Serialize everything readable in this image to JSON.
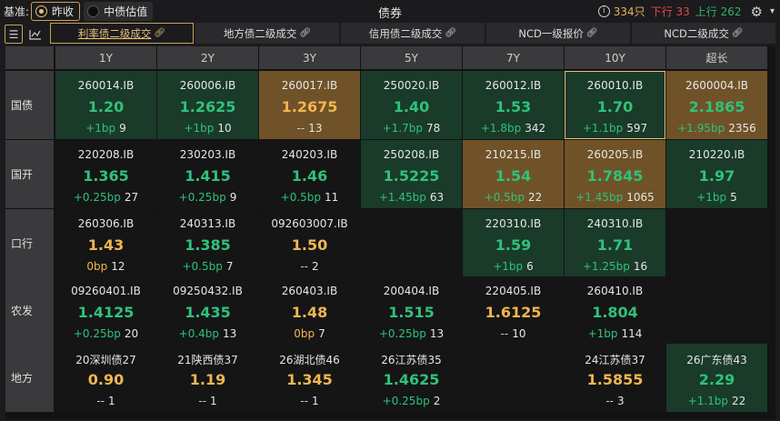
{
  "topbar": {
    "base_label": "基准:",
    "options": [
      {
        "label": "昨收",
        "selected": true
      },
      {
        "label": "中债估值",
        "selected": false
      }
    ],
    "title": "债券",
    "info_icon": "info-icon",
    "count": "334只",
    "down": "下行 33",
    "up": "上行 262",
    "settings_icon": "gear-icon",
    "collapse_icon": "chevron-icon"
  },
  "toolbar": {
    "list_icon": "list-icon",
    "chart_icon": "line-chart-icon"
  },
  "tabs": [
    {
      "label": "利率债二级成交",
      "active": true
    },
    {
      "label": "地方债二级成交",
      "active": false
    },
    {
      "label": "信用债二级成交",
      "active": false
    },
    {
      "label": "NCD一级报价",
      "active": false
    },
    {
      "label": "NCD二级成交",
      "active": false
    }
  ],
  "grid": {
    "columns": [
      "1Y",
      "2Y",
      "3Y",
      "5Y",
      "7Y",
      "10Y",
      "超长"
    ],
    "rows": [
      {
        "label": "国债",
        "cells": [
          {
            "code": "260014.IB",
            "value": "1.20",
            "change": "+1bp",
            "volume": "9",
            "bg": "green",
            "tone": "green"
          },
          {
            "code": "260006.IB",
            "value": "1.2625",
            "change": "+1bp",
            "volume": "10",
            "bg": "green",
            "tone": "green"
          },
          {
            "code": "260017.IB",
            "value": "1.2675",
            "change": "--",
            "volume": "13",
            "bg": "orange",
            "tone": "orange"
          },
          {
            "code": "250020.IB",
            "value": "1.40",
            "change": "+1.7bp",
            "volume": "78",
            "bg": "green",
            "tone": "green"
          },
          {
            "code": "260012.IB",
            "value": "1.53",
            "change": "+1.8bp",
            "volume": "342",
            "bg": "green",
            "tone": "green"
          },
          {
            "code": "260010.IB",
            "value": "1.70",
            "change": "+1.1bp",
            "volume": "597",
            "bg": "green",
            "tone": "green",
            "selected": true
          },
          {
            "code": "2600004.IB",
            "value": "2.1865",
            "change": "+1.95bp",
            "volume": "2356",
            "bg": "orange",
            "tone": "green"
          }
        ]
      },
      {
        "label": "国开",
        "cells": [
          {
            "code": "220208.IB",
            "value": "1.365",
            "change": "+0.25bp",
            "volume": "27",
            "bg": "none",
            "tone": "green"
          },
          {
            "code": "230203.IB",
            "value": "1.415",
            "change": "+0.25bp",
            "volume": "9",
            "bg": "none",
            "tone": "green"
          },
          {
            "code": "240203.IB",
            "value": "1.46",
            "change": "+0.5bp",
            "volume": "11",
            "bg": "none",
            "tone": "green"
          },
          {
            "code": "250208.IB",
            "value": "1.5225",
            "change": "+1.45bp",
            "volume": "63",
            "bg": "green",
            "tone": "green"
          },
          {
            "code": "210215.IB",
            "value": "1.54",
            "change": "+0.5bp",
            "volume": "22",
            "bg": "orange",
            "tone": "green"
          },
          {
            "code": "260205.IB",
            "value": "1.7845",
            "change": "+1.45bp",
            "volume": "1065",
            "bg": "orange",
            "tone": "green"
          },
          {
            "code": "210220.IB",
            "value": "1.97",
            "change": "+1bp",
            "volume": "5",
            "bg": "green",
            "tone": "green"
          }
        ]
      },
      {
        "label": "口行",
        "cells": [
          {
            "code": "260306.IB",
            "value": "1.43",
            "change": "0bp",
            "volume": "12",
            "bg": "none",
            "tone": "orange"
          },
          {
            "code": "240313.IB",
            "value": "1.385",
            "change": "+0.5bp",
            "volume": "7",
            "bg": "none",
            "tone": "green"
          },
          {
            "code": "092603007.IB",
            "value": "1.50",
            "change": "--",
            "volume": "2",
            "bg": "none",
            "tone": "orange"
          },
          null,
          {
            "code": "220310.IB",
            "value": "1.59",
            "change": "+1bp",
            "volume": "6",
            "bg": "green",
            "tone": "green"
          },
          {
            "code": "240310.IB",
            "value": "1.71",
            "change": "+1.25bp",
            "volume": "16",
            "bg": "green",
            "tone": "green"
          },
          null
        ]
      },
      {
        "label": "农发",
        "cells": [
          {
            "code": "09260401.IB",
            "value": "1.4125",
            "change": "+0.25bp",
            "volume": "20",
            "bg": "none",
            "tone": "green"
          },
          {
            "code": "09250432.IB",
            "value": "1.435",
            "change": "+0.4bp",
            "volume": "13",
            "bg": "none",
            "tone": "green"
          },
          {
            "code": "260403.IB",
            "value": "1.48",
            "change": "0bp",
            "volume": "7",
            "bg": "none",
            "tone": "orange"
          },
          {
            "code": "200404.IB",
            "value": "1.515",
            "change": "+0.25bp",
            "volume": "13",
            "bg": "none",
            "tone": "green"
          },
          {
            "code": "220405.IB",
            "value": "1.6125",
            "change": "--",
            "volume": "10",
            "bg": "none",
            "tone": "orange"
          },
          {
            "code": "260410.IB",
            "value": "1.804",
            "change": "+1bp",
            "volume": "114",
            "bg": "none",
            "tone": "green"
          },
          null
        ]
      },
      {
        "label": "地方",
        "cells": [
          {
            "code": "20深圳债27",
            "value": "0.90",
            "change": "--",
            "volume": "1",
            "bg": "none",
            "tone": "orange"
          },
          {
            "code": "21陕西债37",
            "value": "1.19",
            "change": "--",
            "volume": "1",
            "bg": "none",
            "tone": "orange"
          },
          {
            "code": "26湖北债46",
            "value": "1.345",
            "change": "--",
            "volume": "1",
            "bg": "none",
            "tone": "orange"
          },
          {
            "code": "26江苏债35",
            "value": "1.4625",
            "change": "+0.25bp",
            "volume": "2",
            "bg": "none",
            "tone": "green"
          },
          null,
          {
            "code": "24江苏债37",
            "value": "1.5855",
            "change": "--",
            "volume": "3",
            "bg": "none",
            "tone": "orange"
          },
          {
            "code": "26广东债43",
            "value": "2.29",
            "change": "+1.1bp",
            "volume": "22",
            "bg": "green",
            "tone": "green"
          }
        ]
      }
    ]
  }
}
